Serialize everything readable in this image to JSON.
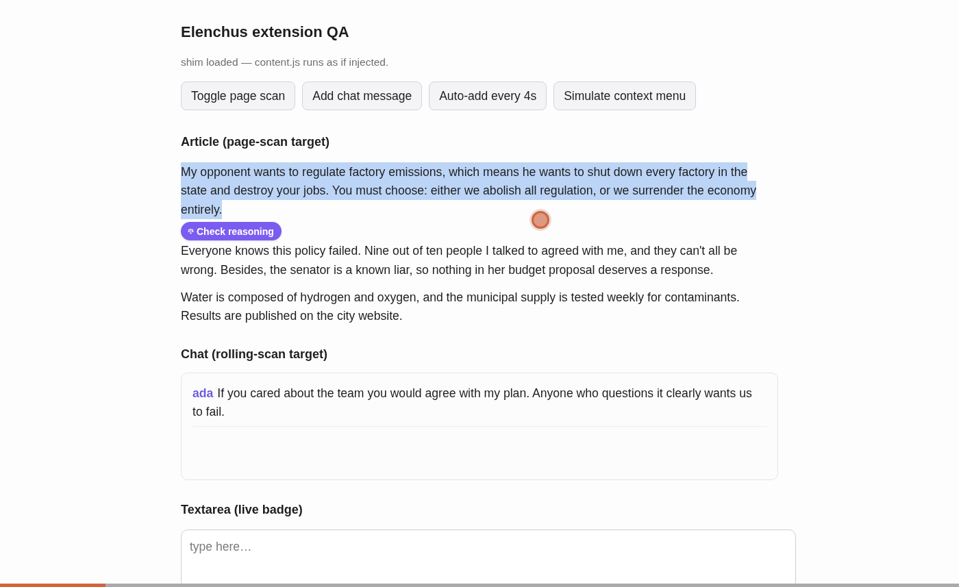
{
  "page": {
    "title": "Elenchus extension QA",
    "status": "shim loaded — content.js runs as if injected."
  },
  "toolbar": {
    "buttons": [
      "Toggle page scan",
      "Add chat message",
      "Auto-add every 4s",
      "Simulate context menu"
    ]
  },
  "article": {
    "heading": "Article (page-scan target)",
    "paragraphs": [
      {
        "text": "My opponent wants to regulate factory emissions, which means he wants to shut down every factory in the state and destroy your jobs. You must choose: either we abolish all regulation, or we surrender the economy entirely.",
        "selected": true
      },
      {
        "text": "Everyone knows this policy failed. Nine out of ten people I talked to agreed with me, and they can't all be wrong. Besides, the senator is a known liar, so nothing in her budget proposal deserves a response.",
        "selected": false
      },
      {
        "text": "Water is composed of hydrogen and oxygen, and the municipal supply is tested weekly for contaminants. Results are published on the city website.",
        "selected": false
      }
    ],
    "badge": {
      "label": "Check reasoning"
    }
  },
  "chat": {
    "heading": "Chat (rolling-scan target)",
    "messages": [
      {
        "author": "ada",
        "text": "If you cared about the team you would agree with my plan. Anyone who questions it clearly wants us to fail."
      }
    ]
  },
  "textarea_section": {
    "heading": "Textarea (live badge)",
    "placeholder": "type here…"
  },
  "progress_bar": {
    "level": 0.11
  }
}
